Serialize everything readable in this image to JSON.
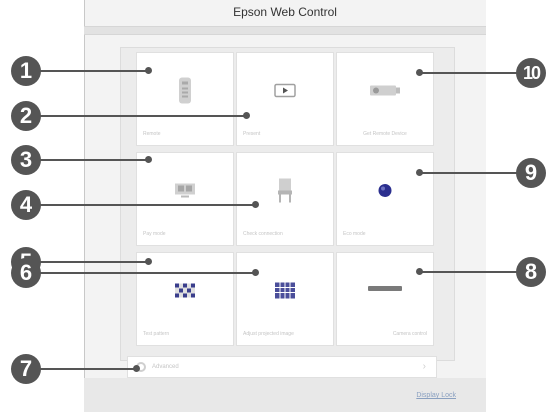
{
  "window": {
    "title": "Epson Web Control"
  },
  "tiles": [
    {
      "label": "Remote",
      "icon": "remote-control-icon"
    },
    {
      "label": "Present",
      "icon": "presentation-screen-icon"
    },
    {
      "label": "Get Remote Device",
      "icon": "projector-icon"
    },
    {
      "label": "Pay mode",
      "icon": "monitor-icon"
    },
    {
      "label": "Check connection",
      "icon": "chair-icon"
    },
    {
      "label": "Eco mode",
      "icon": "eco-leaf-icon"
    },
    {
      "label": "Test pattern",
      "icon": "test-pattern-icon"
    },
    {
      "label": "Adjust projected image",
      "icon": "grid-adjust-icon"
    },
    {
      "label": "Camera control",
      "icon": "camera-bar-icon"
    }
  ],
  "menu": {
    "label": "Advanced",
    "chevron": "›",
    "icon": "gear-icon"
  },
  "footer": {
    "link": "Display Lock"
  },
  "callouts": [
    "1",
    "2",
    "3",
    "4",
    "5",
    "6",
    "7",
    "8",
    "9",
    "10"
  ],
  "colors": {
    "callout": "#555555",
    "icon_gray": "#9a9a9a",
    "icon_blue": "#2b2f8f"
  }
}
